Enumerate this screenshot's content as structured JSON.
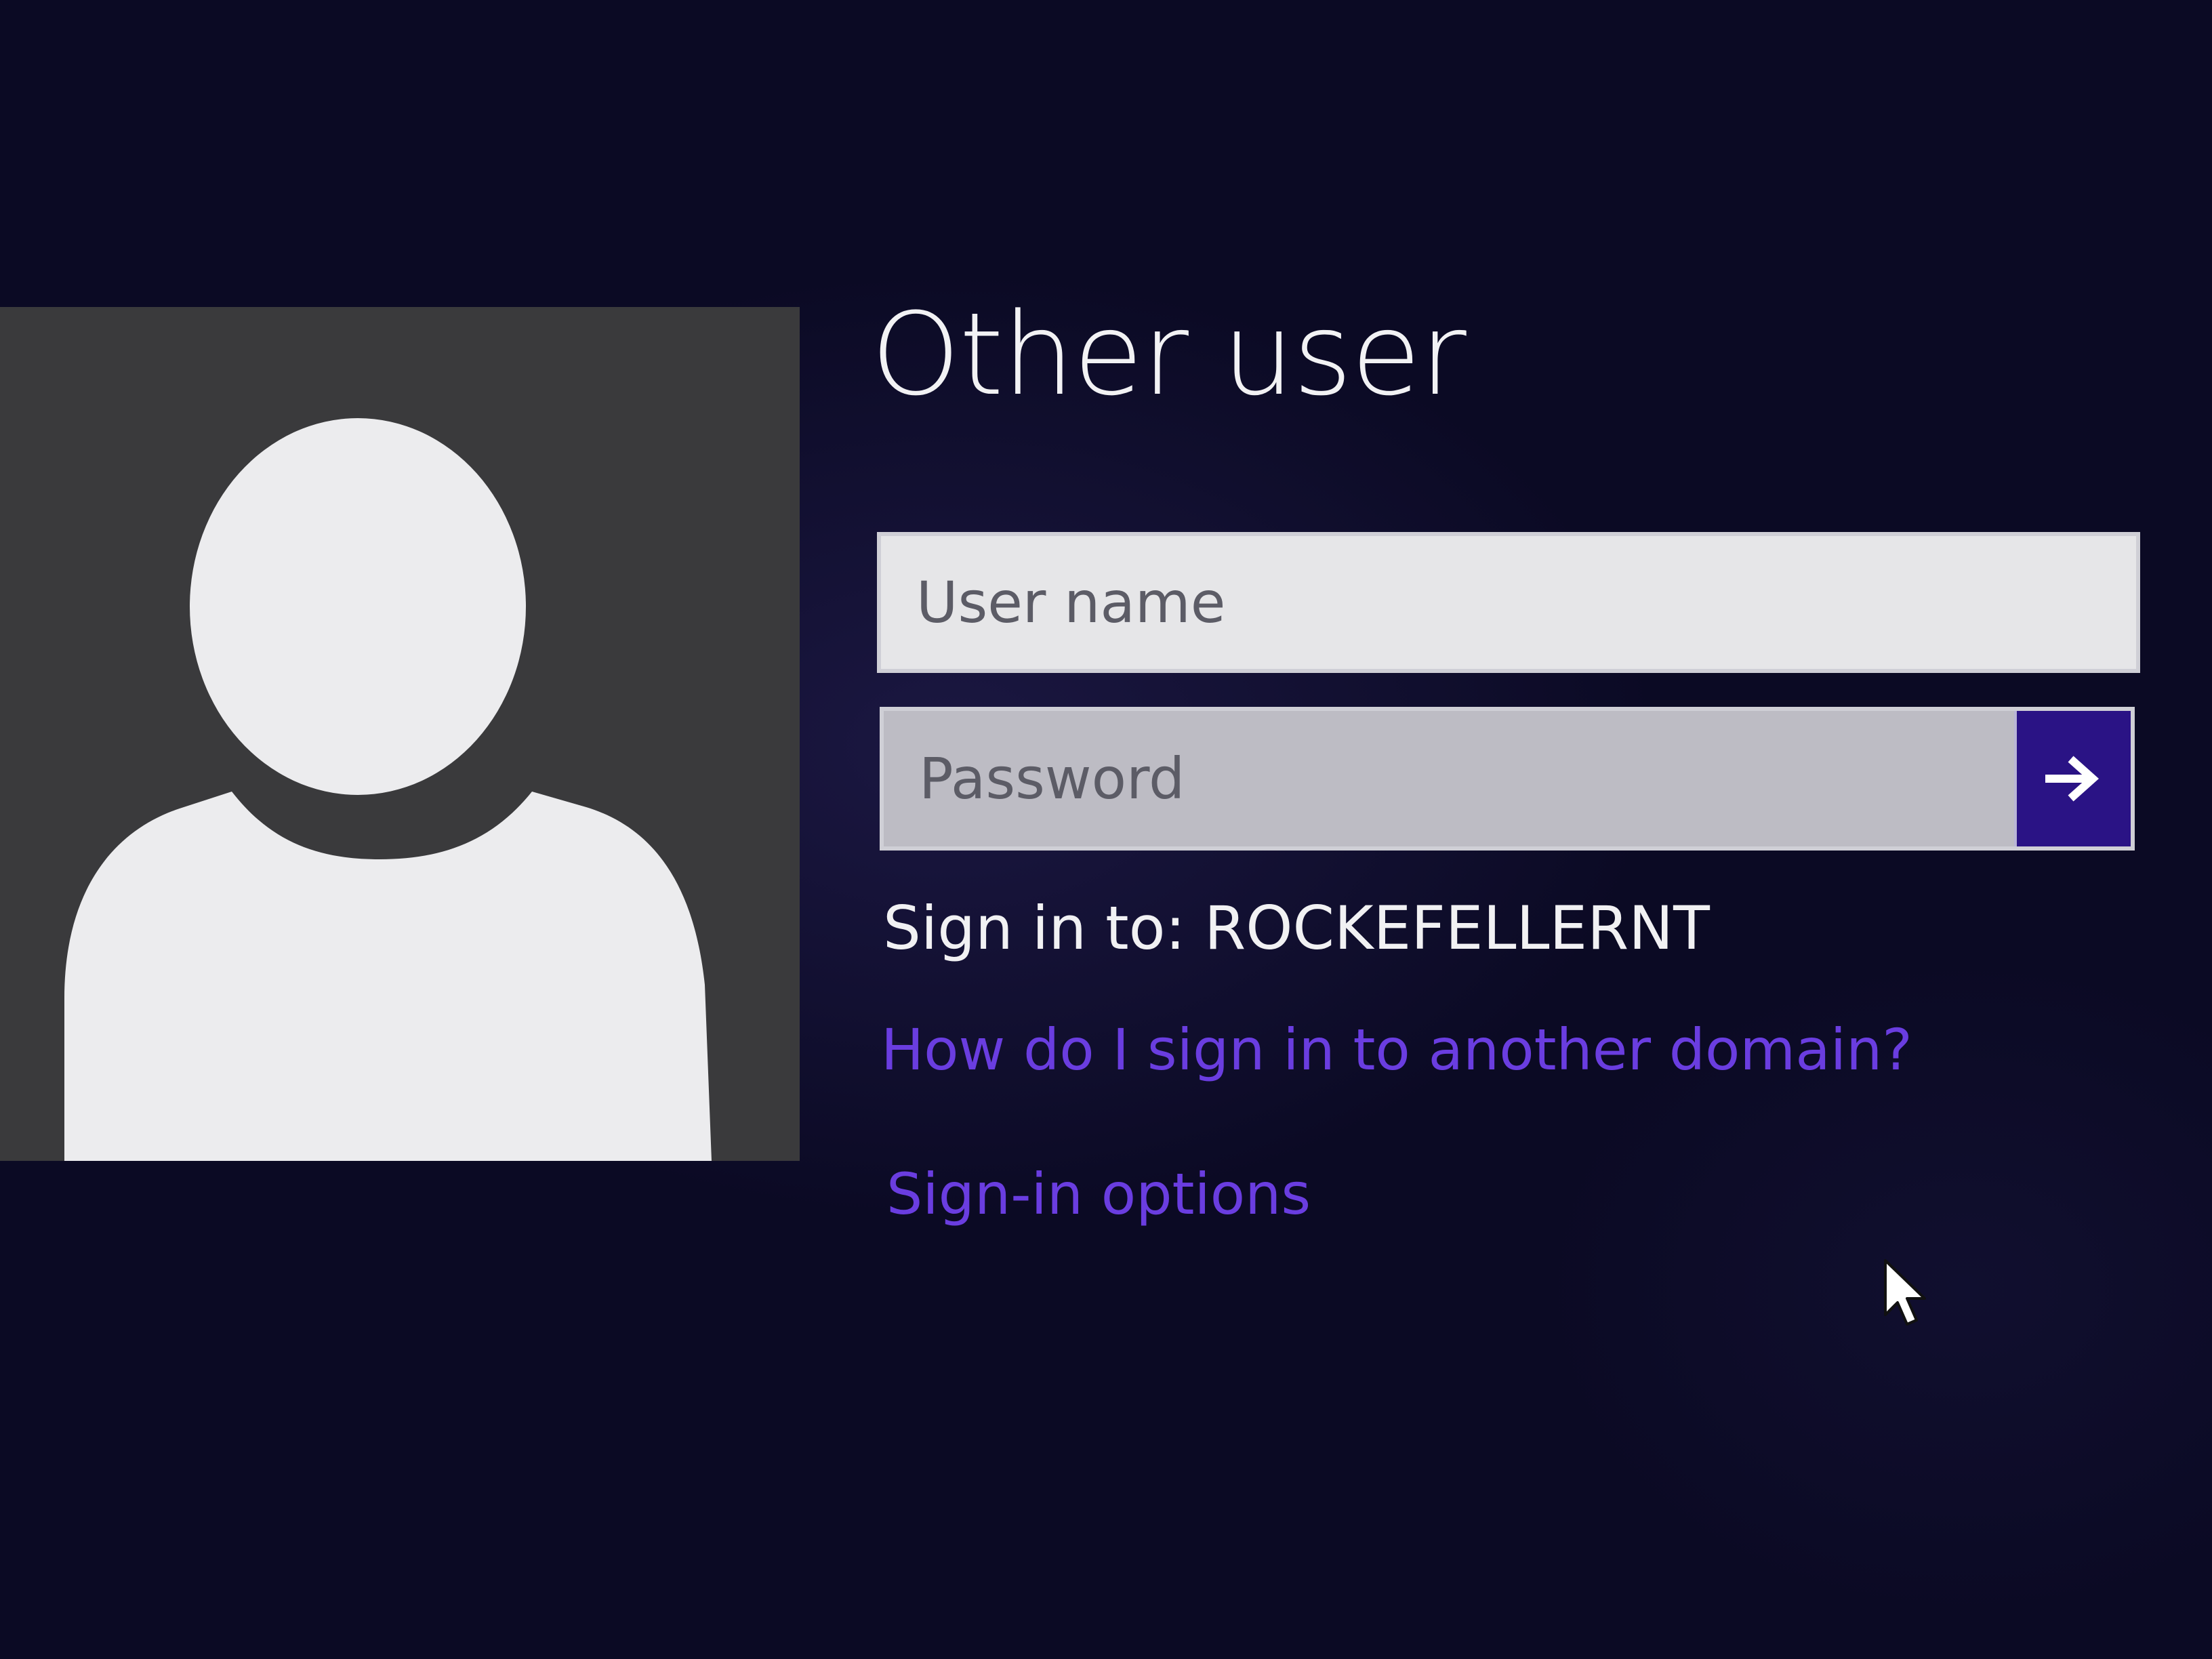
{
  "user_tile": {
    "icon": "default-user-avatar-icon"
  },
  "login": {
    "title": "Other user",
    "username_placeholder": "User name",
    "username_value": "",
    "password_placeholder": "Password",
    "password_value": "",
    "submit_icon": "arrow-right-icon",
    "sign_in_to": "Sign in to: ROCKEFELLERNT",
    "domain_help_link": "How do I sign in to another domain?",
    "sign_in_options_link": "Sign-in options"
  },
  "colors": {
    "background": "#0b0a24",
    "accent": "#2a1385",
    "link": "#6a3de0",
    "tile": "#3a3a3c"
  }
}
